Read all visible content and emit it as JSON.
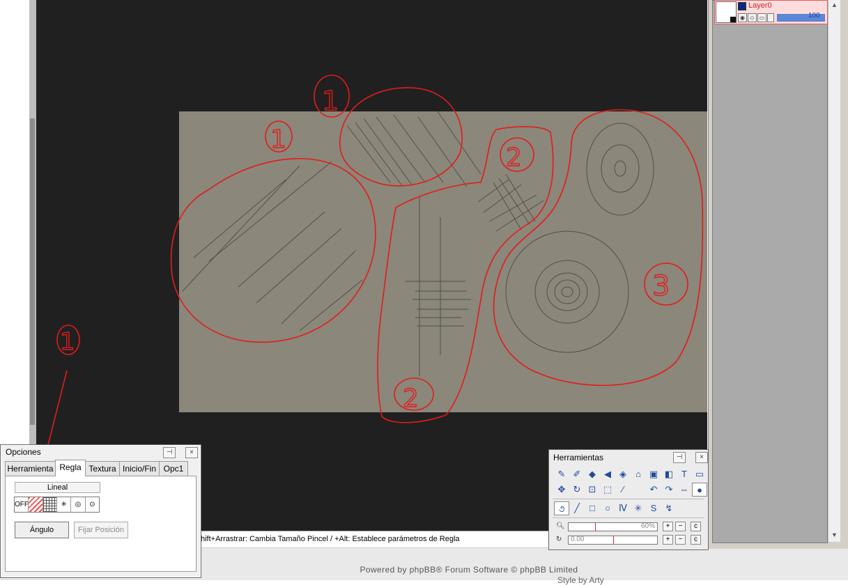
{
  "layers": {
    "name": "Layer0",
    "opacity": "100",
    "opacity_fraction": 1.0
  },
  "options_panel": {
    "title": "Opciones",
    "pin_icon": "pin-icon",
    "close_icon": "close-icon",
    "tabs": [
      {
        "label": "Herramienta",
        "active": false
      },
      {
        "label": "Regla",
        "active": true
      },
      {
        "label": "Textura",
        "active": false
      },
      {
        "label": "Inicio/Fin",
        "active": false
      },
      {
        "label": "Opc1",
        "active": false
      }
    ],
    "ruler_mode": "Lineal",
    "ruler_off_label": "OFF",
    "angle_button": "Ángulo",
    "fix_position_button": "Fijar Posición"
  },
  "tools_panel": {
    "title": "Herramientas",
    "zoom_value": "60%",
    "zoom_fraction": 0.3,
    "rotation_value": "0.00",
    "rotation_fraction": 0.5,
    "reset_label": "c"
  },
  "status_bar": {
    "text": "hift+Arrastrar: Cambia Tamaño Pincel / +Alt: Establece parámetros de Regla"
  },
  "footer": {
    "powered_by": "Powered by phpBB® Forum Software © phpBB Limited",
    "style_by": "Style by Arty"
  },
  "annotation_numbers": [
    "1",
    "1",
    "1",
    "2",
    "2",
    "3"
  ],
  "colors": {
    "canvas_bg": "#202020",
    "paper": "#8b877a",
    "annotation_red": "#e31b1b",
    "layer_highlight": "#ffdcdc"
  }
}
